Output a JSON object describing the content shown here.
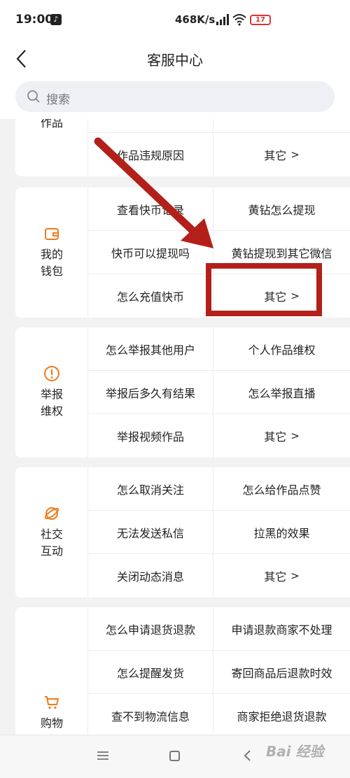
{
  "status_bar": {
    "time": "19:00",
    "net_speed": "468K/s",
    "battery": "17"
  },
  "nav": {
    "title": "客服中心"
  },
  "search": {
    "placeholder": "搜索"
  },
  "sections": [
    {
      "label": "作品",
      "icon": "works-icon",
      "cells": [
        [
          "作品违规原因",
          "其它"
        ]
      ]
    },
    {
      "label": "我的\n钱包",
      "icon": "wallet-icon",
      "cells": [
        [
          "查看快币记录",
          "黄钻怎么提现"
        ],
        [
          "快币可以提现吗",
          "黄钻提现到其它微信"
        ],
        [
          "怎么充值快币",
          "其它"
        ]
      ]
    },
    {
      "label": "举报\n维权",
      "icon": "alert-icon",
      "cells": [
        [
          "怎么举报其他用户",
          "个人作品维权"
        ],
        [
          "举报后多久有结果",
          "怎么举报直播"
        ],
        [
          "举报视频作品",
          "其它"
        ]
      ]
    },
    {
      "label": "社交\n互动",
      "icon": "planet-icon",
      "cells": [
        [
          "怎么取消关注",
          "怎么给作品点赞"
        ],
        [
          "无法发送私信",
          "拉黑的效果"
        ],
        [
          "关闭动态消息",
          "其它"
        ]
      ]
    },
    {
      "label": "购物",
      "icon": "cart-icon",
      "cells": [
        [
          "怎么申请退货退款",
          "申请退款商家不处理"
        ],
        [
          "怎么提醒发货",
          "寄回商品后退款时效"
        ],
        [
          "查不到物流信息",
          "商家拒绝退货退款"
        ]
      ]
    }
  ],
  "more_chevron": ">",
  "watermark": "Bai 经验",
  "colors": {
    "accent": "#f07a1a",
    "annotation": "#b3201a"
  }
}
